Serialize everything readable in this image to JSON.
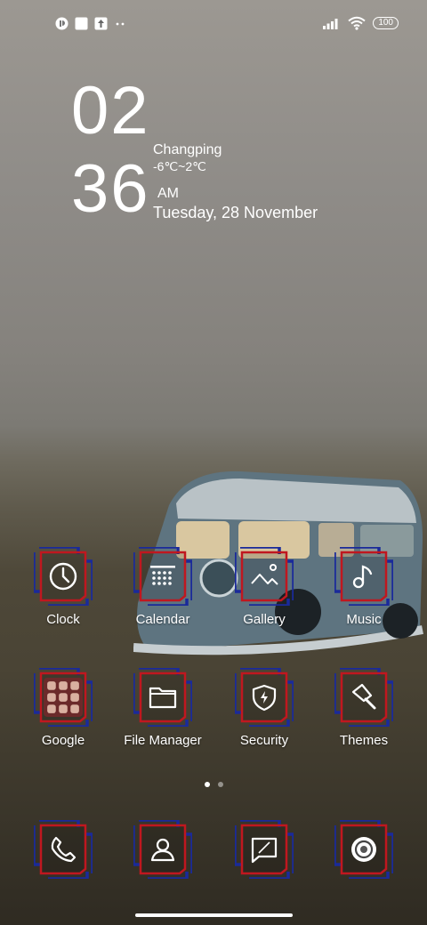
{
  "status_bar": {
    "left_icons": [
      "app-notification-icon",
      "square-notification-icon",
      "upload-notification-icon",
      "more-notifications-icon"
    ],
    "right_icons": [
      "signal-icon",
      "wifi-icon",
      "battery-icon"
    ],
    "battery": "100"
  },
  "lock_widget": {
    "hour": "02",
    "minute": "36",
    "ampm": "AM",
    "city": "Changping",
    "temperature": "-6℃~2℃",
    "date": "Tuesday, 28 November"
  },
  "apps_row1": [
    {
      "label": "Clock",
      "icon": "clock-icon"
    },
    {
      "label": "Calendar",
      "icon": "calendar-icon"
    },
    {
      "label": "Gallery",
      "icon": "gallery-icon"
    },
    {
      "label": "Music",
      "icon": "music-icon"
    }
  ],
  "apps_row2": [
    {
      "label": "Google",
      "icon": "google-folder-icon"
    },
    {
      "label": "File Manager",
      "icon": "folder-icon"
    },
    {
      "label": "Security",
      "icon": "shield-icon"
    },
    {
      "label": "Themes",
      "icon": "brush-icon"
    }
  ],
  "dock": [
    {
      "icon": "phone-icon"
    },
    {
      "icon": "contacts-icon"
    },
    {
      "icon": "message-icon"
    },
    {
      "icon": "camera-icon"
    }
  ],
  "page_indicator": {
    "pages": 2,
    "current": 1
  },
  "colors": {
    "frame_red": "#c0171f",
    "frame_blue": "#1a2a9a"
  }
}
